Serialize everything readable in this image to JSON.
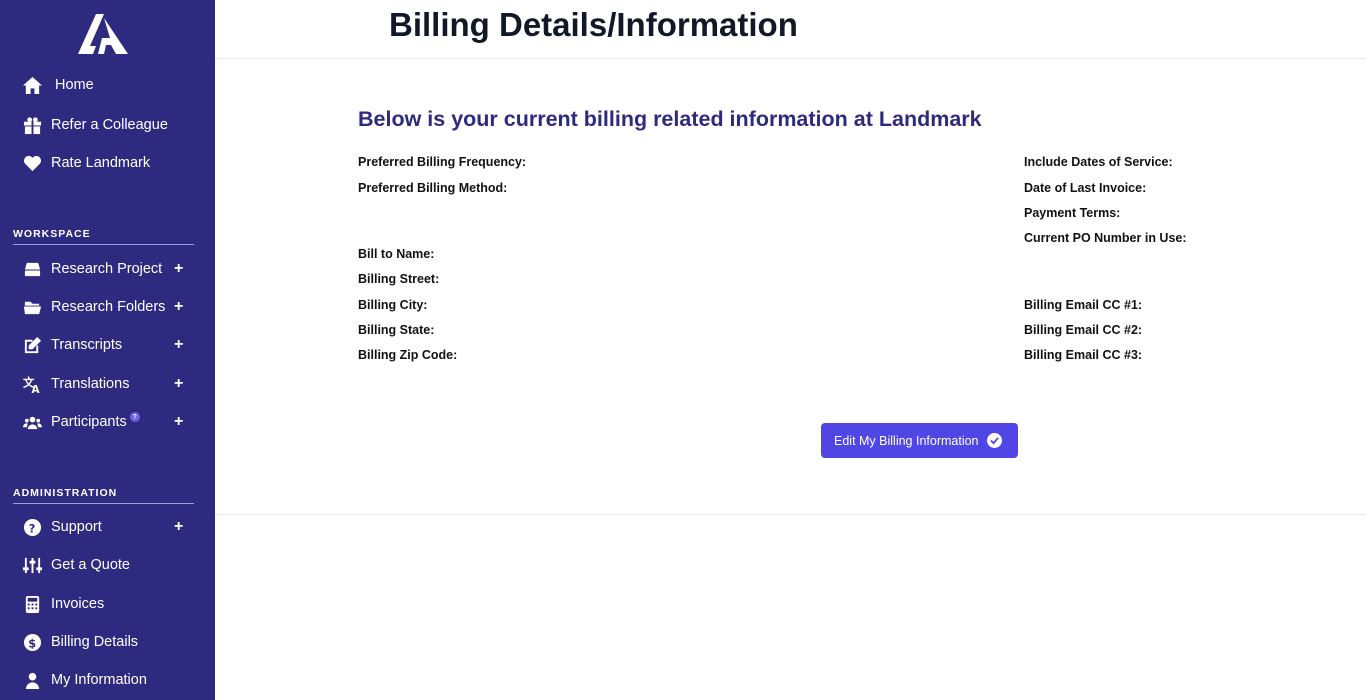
{
  "sidebar": {
    "logo": "landmark-logo",
    "top_items": [
      {
        "label": "Home",
        "icon": "home-icon"
      },
      {
        "label": "Refer a Colleague",
        "icon": "gift-icon"
      },
      {
        "label": "Rate Landmark",
        "icon": "heart-icon"
      }
    ],
    "workspace": {
      "heading": "WORKSPACE",
      "items": [
        {
          "label": "Research Project",
          "icon": "hdd-icon",
          "plus": "+"
        },
        {
          "label": "Research Folders",
          "icon": "folder-open-icon",
          "plus": "+"
        },
        {
          "label": "Transcripts",
          "icon": "edit-icon",
          "plus": "+"
        },
        {
          "label": "Translations",
          "icon": "language-icon",
          "plus": "+"
        },
        {
          "label": "Participants",
          "icon": "users-icon",
          "plus": "+",
          "badge": "?"
        }
      ]
    },
    "administration": {
      "heading": "ADMINISTRATION",
      "items": [
        {
          "label": "Support",
          "icon": "question-circle-icon",
          "plus": "+"
        },
        {
          "label": "Get a Quote",
          "icon": "sliders-icon"
        },
        {
          "label": "Invoices",
          "icon": "calculator-icon"
        },
        {
          "label": "Billing Details",
          "icon": "dollar-circle-icon"
        },
        {
          "label": "My Information",
          "icon": "user-icon"
        }
      ]
    }
  },
  "header": {
    "title": "Billing Details/Information"
  },
  "main": {
    "subtitle": "Below is your current billing related information at Landmark",
    "left_fields": [
      {
        "label": "Preferred Billing Frequency:",
        "value": ""
      },
      {
        "label": "Preferred Billing Method:",
        "value": ""
      },
      {
        "label": "Bill to Name:",
        "value": ""
      },
      {
        "label": "Billing Street:",
        "value": ""
      },
      {
        "label": "Billing City:",
        "value": ""
      },
      {
        "label": "Billing State:",
        "value": ""
      },
      {
        "label": "Billing Zip Code:",
        "value": ""
      }
    ],
    "right_fields": [
      {
        "label": "Include Dates of Service:",
        "value": ""
      },
      {
        "label": "Date of Last Invoice:",
        "value": ""
      },
      {
        "label": "Payment Terms:",
        "value": ""
      },
      {
        "label": "Current PO Number in Use:",
        "value": ""
      },
      {
        "label": "Billing Email CC #1:",
        "value": ""
      },
      {
        "label": "Billing Email CC #2:",
        "value": ""
      },
      {
        "label": "Billing Email CC #3:",
        "value": ""
      }
    ],
    "edit_button": {
      "label": "Edit My Billing Information",
      "icon": "check-circle-icon"
    }
  },
  "colors": {
    "sidebar_bg": "#2e2a7f",
    "accent": "#4f46e5",
    "subtitle": "#2e2a7f"
  }
}
